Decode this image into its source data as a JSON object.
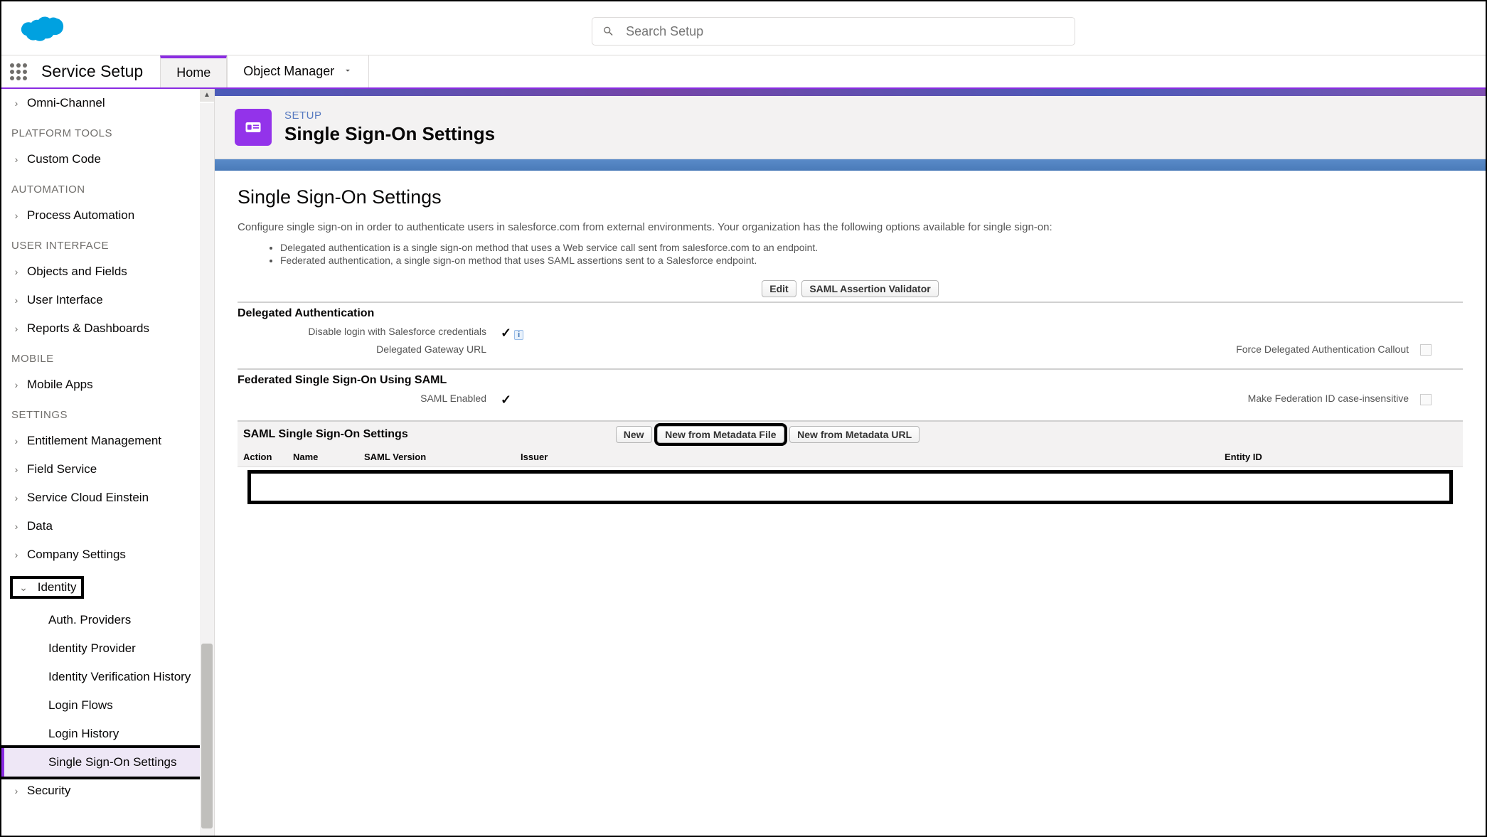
{
  "header": {
    "search_placeholder": "Search Setup"
  },
  "appbar": {
    "app_name": "Service Setup",
    "tabs": [
      {
        "label": "Home",
        "active": true
      },
      {
        "label": "Object Manager",
        "active": false
      }
    ]
  },
  "sidebar": {
    "items": [
      {
        "type": "item",
        "label": "Omni-Channel"
      },
      {
        "type": "group",
        "label": "PLATFORM TOOLS"
      },
      {
        "type": "item",
        "label": "Custom Code"
      },
      {
        "type": "group",
        "label": "AUTOMATION"
      },
      {
        "type": "item",
        "label": "Process Automation"
      },
      {
        "type": "group",
        "label": "USER INTERFACE"
      },
      {
        "type": "item",
        "label": "Objects and Fields"
      },
      {
        "type": "item",
        "label": "User Interface"
      },
      {
        "type": "item",
        "label": "Reports & Dashboards"
      },
      {
        "type": "group",
        "label": "MOBILE"
      },
      {
        "type": "item",
        "label": "Mobile Apps"
      },
      {
        "type": "group",
        "label": "SETTINGS"
      },
      {
        "type": "item",
        "label": "Entitlement Management"
      },
      {
        "type": "item",
        "label": "Field Service"
      },
      {
        "type": "item",
        "label": "Service Cloud Einstein"
      },
      {
        "type": "item",
        "label": "Data"
      },
      {
        "type": "item",
        "label": "Company Settings"
      },
      {
        "type": "item",
        "label": "Identity",
        "expanded": true,
        "highlighted": true
      },
      {
        "type": "sub",
        "label": "Auth. Providers"
      },
      {
        "type": "sub",
        "label": "Identity Provider"
      },
      {
        "type": "sub",
        "label": "Identity Verification History"
      },
      {
        "type": "sub",
        "label": "Login Flows"
      },
      {
        "type": "sub",
        "label": "Login History"
      },
      {
        "type": "sub",
        "label": "Single Sign-On Settings",
        "active": true,
        "highlighted": true
      },
      {
        "type": "item",
        "label": "Security"
      }
    ]
  },
  "page": {
    "crumb": "SETUP",
    "title": "Single Sign-On Settings",
    "heading": "Single Sign-On Settings",
    "intro": "Configure single sign-on in order to authenticate users in salesforce.com from external environments. Your organization has the following options available for single sign-on:",
    "bullets": [
      "Delegated authentication is a single sign-on method that uses a Web service call sent from salesforce.com to an endpoint.",
      "Federated authentication, a single sign-on method that uses SAML assertions sent to a Salesforce endpoint."
    ],
    "buttons": {
      "edit": "Edit",
      "saml_validator": "SAML Assertion Validator"
    },
    "delegated": {
      "title": "Delegated Authentication",
      "disable_login_label": "Disable login with Salesforce credentials",
      "disable_login_checked": true,
      "gateway_label": "Delegated Gateway URL",
      "force_callout_label": "Force Delegated Authentication Callout",
      "force_callout_checked": false
    },
    "federated": {
      "title": "Federated Single Sign-On Using SAML",
      "saml_enabled_label": "SAML Enabled",
      "saml_enabled_checked": true,
      "case_insensitive_label": "Make Federation ID case-insensitive",
      "case_insensitive_checked": false
    },
    "saml_settings": {
      "title": "SAML Single Sign-On Settings",
      "buttons": {
        "new": "New",
        "from_file": "New from Metadata File",
        "from_url": "New from Metadata URL"
      },
      "columns": {
        "action": "Action",
        "name": "Name",
        "version": "SAML Version",
        "issuer": "Issuer",
        "entity": "Entity ID"
      }
    }
  }
}
